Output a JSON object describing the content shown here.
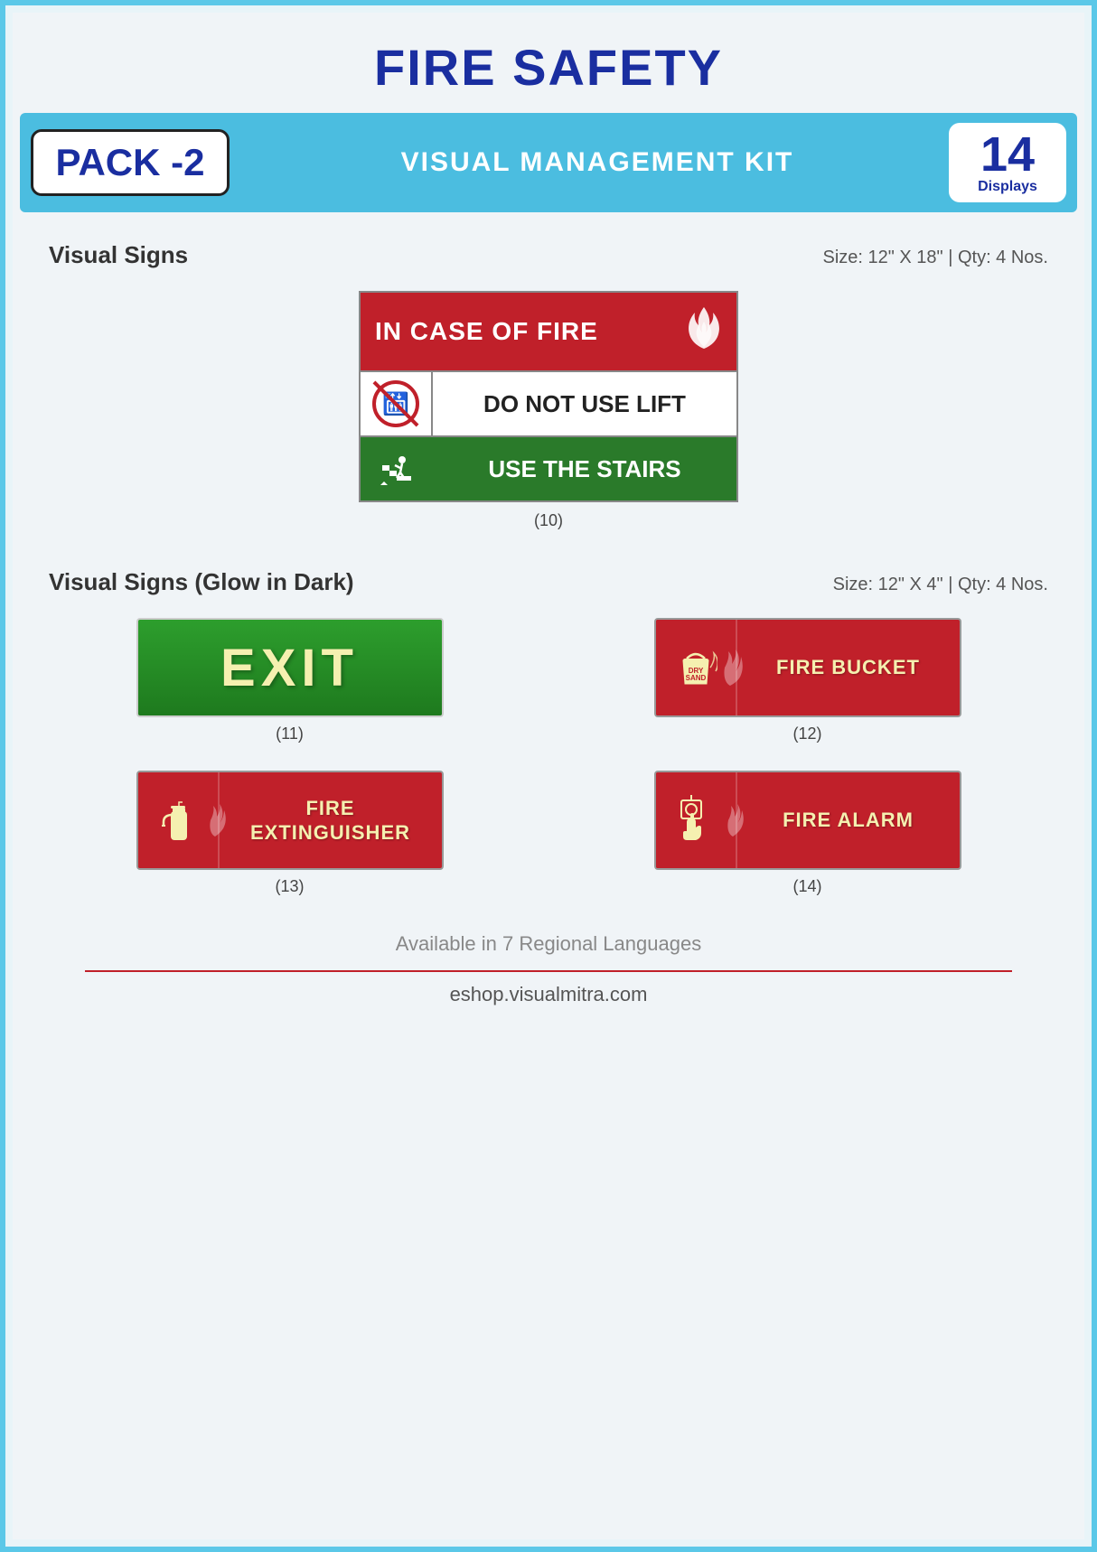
{
  "header": {
    "title": "FIRE SAFETY"
  },
  "pack": {
    "label": "PACK -2",
    "subtitle": "VISUAL MANAGEMENT KIT",
    "displays_num": "14",
    "displays_text": "Displays"
  },
  "section1": {
    "title": "Visual Signs",
    "size_qty": "Size: 12\" X 18\" | Qty: 4 Nos.",
    "sign10": {
      "top_text": "IN CASE OF FIRE",
      "middle_text": "DO NOT USE LIFT",
      "bottom_text": "USE THE STAIRS",
      "caption": "(10)"
    }
  },
  "section2": {
    "title": "Visual Signs (Glow in Dark)",
    "size_qty": "Size: 12\" X 4\" | Qty: 4 Nos.",
    "signs": [
      {
        "id": "11",
        "text": "EXIT",
        "type": "exit",
        "caption": "(11)"
      },
      {
        "id": "12",
        "text": "FIRE BUCKET",
        "type": "bucket",
        "caption": "(12)"
      },
      {
        "id": "13",
        "text": "FIRE\nEXTINGUISHER",
        "type": "extinguisher",
        "caption": "(13)"
      },
      {
        "id": "14",
        "text": "FIRE ALARM",
        "type": "alarm",
        "caption": "(14)"
      }
    ]
  },
  "footer": {
    "langs": "Available in 7 Regional Languages",
    "url": "eshop.visualmitra.com"
  }
}
